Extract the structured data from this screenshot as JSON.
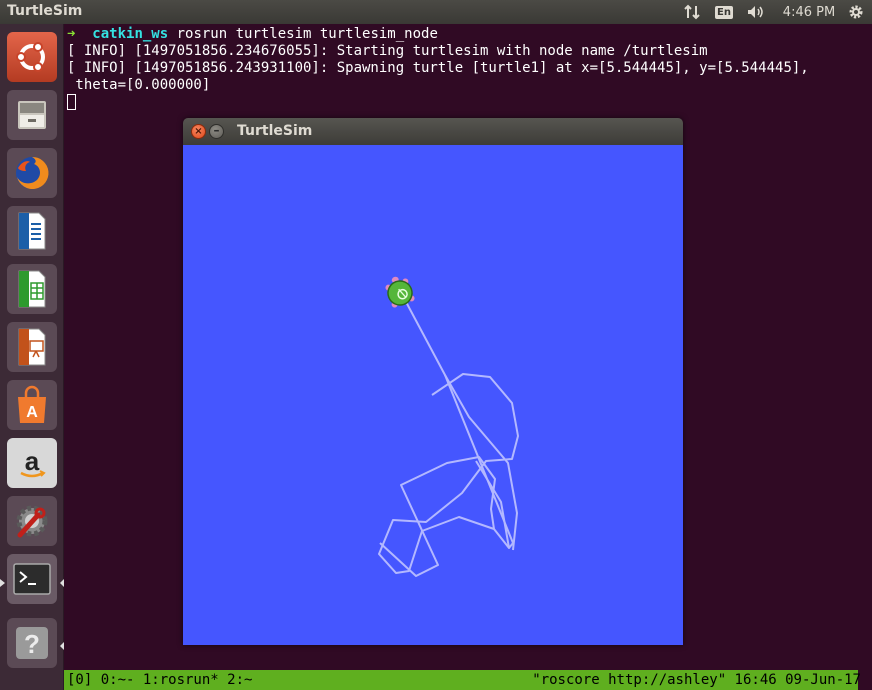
{
  "panel": {
    "app_title": "TurtleSim",
    "keyboard_layout": "En",
    "clock": "4:46 PM"
  },
  "launcher": {
    "items": [
      {
        "name": "dash-home",
        "icon": "ubuntu-logo-icon"
      },
      {
        "name": "files",
        "icon": "file-cabinet-icon"
      },
      {
        "name": "firefox",
        "icon": "firefox-icon"
      },
      {
        "name": "libreoffice-writer",
        "icon": "writer-document-icon"
      },
      {
        "name": "libreoffice-calc",
        "icon": "calc-spreadsheet-icon"
      },
      {
        "name": "libreoffice-impress",
        "icon": "impress-presentation-icon"
      },
      {
        "name": "ubuntu-software",
        "icon": "shopping-bag-icon"
      },
      {
        "name": "amazon",
        "icon": "amazon-icon"
      },
      {
        "name": "system-settings",
        "icon": "settings-wrench-icon"
      },
      {
        "name": "terminal",
        "icon": "terminal-icon"
      },
      {
        "name": "help",
        "icon": "question-mark-icon"
      }
    ]
  },
  "terminal": {
    "prompt_arrow": "➜",
    "prompt_dir": "catkin_ws",
    "command": "rosrun turtlesim turtlesim_node",
    "lines": [
      "[ INFO] [1497051856.234676055]: Starting turtlesim with node name /turtlesim",
      "[ INFO] [1497051856.243931100]: Spawning turtle [turtle1] at x=[5.544445], y=[5.544445],",
      " theta=[0.000000]"
    ]
  },
  "tmux": {
    "left": "[0] 0:~- 1:rosrun* 2:~",
    "right": "\"roscore http://ashley\" 16:46 09-Jun-17"
  },
  "turtlesim": {
    "title": "TurtleSim",
    "close_label": "×",
    "minimize_label": "–",
    "background_color": "#4556ff",
    "pen_color": "#b3b8ff"
  }
}
